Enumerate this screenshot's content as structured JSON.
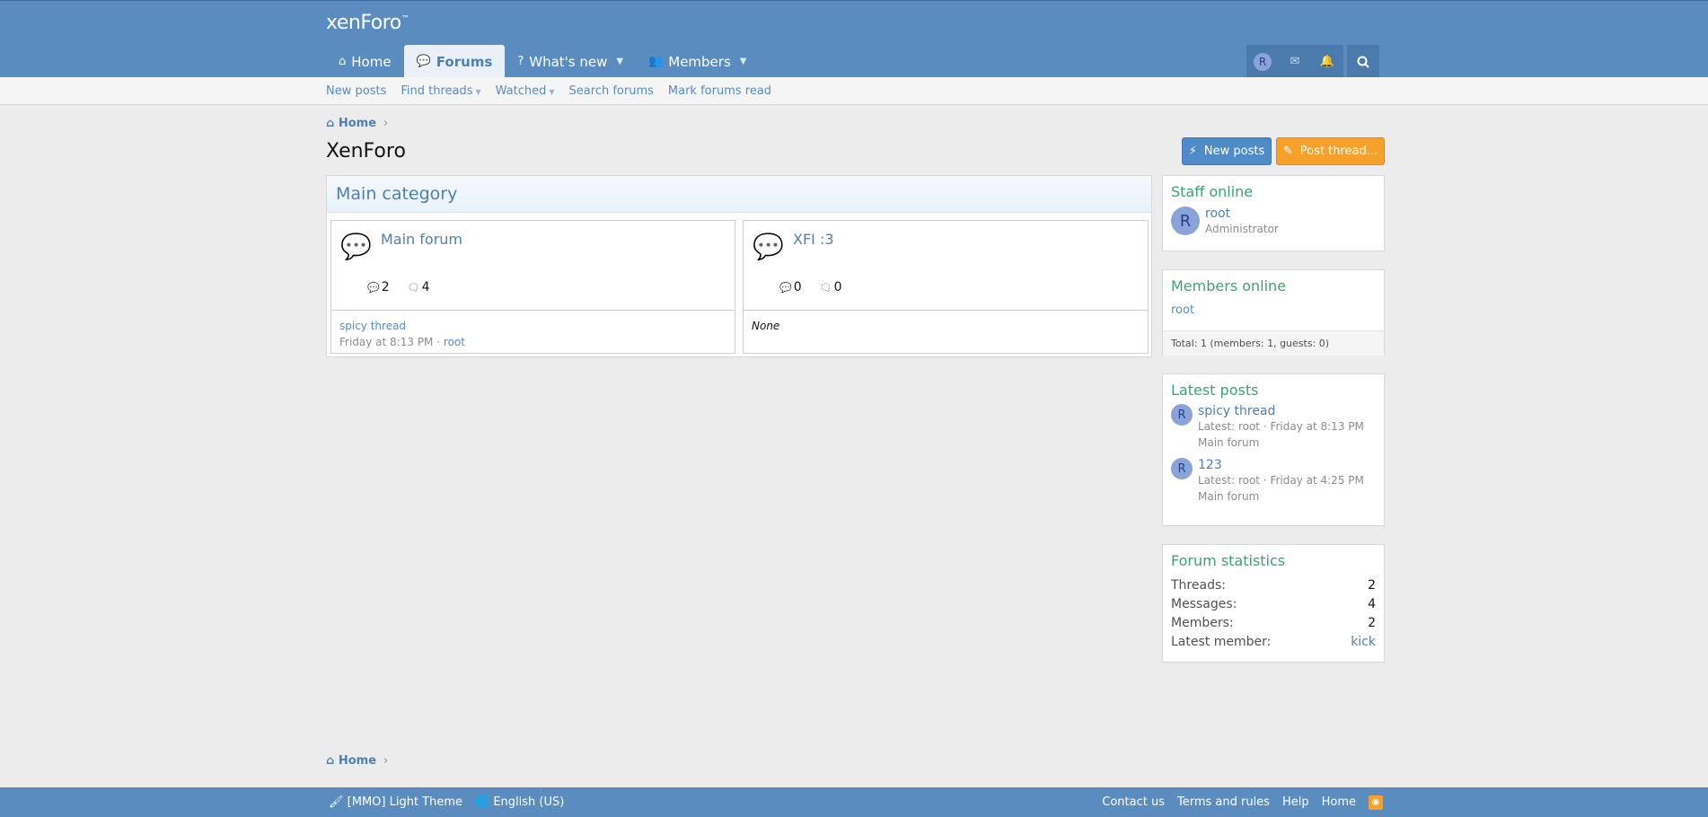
{
  "header": {
    "logo": "xenForo",
    "logo_mark": "™",
    "tabs": [
      {
        "label": "Home",
        "icon": "home-icon"
      },
      {
        "label": "Forums",
        "icon": "comment-icon"
      },
      {
        "label": "What's new",
        "icon": "question-icon"
      },
      {
        "label": "Members",
        "icon": "users-icon"
      }
    ],
    "user_tools": {
      "avatar_letter": "R"
    }
  },
  "subnav": {
    "items": [
      "New posts",
      "Find threads",
      "Watched",
      "Search forums",
      "Mark forums read"
    ]
  },
  "breadcrumb": {
    "home": "Home",
    "sep": "›"
  },
  "page": {
    "title": "XenForo",
    "new_posts_button": "New posts",
    "post_thread_button": "Post thread..."
  },
  "category": {
    "title": "Main category",
    "forums": [
      {
        "title": "Main forum",
        "threads": "2",
        "messages": "4",
        "last_thread": "spicy thread",
        "last_date": "Friday at 8:13 PM",
        "last_sep": "·",
        "last_user": "root"
      },
      {
        "title": "XFI :3",
        "threads": "0",
        "messages": "0",
        "last_none": "None"
      }
    ]
  },
  "sidebar": {
    "staff": {
      "title": "Staff online",
      "name": "root",
      "role": "Administrator",
      "avatar_letter": "R"
    },
    "members": {
      "title": "Members online",
      "list": "root",
      "total": "Total: 1 (members: 1, guests: 0)"
    },
    "latest": {
      "title": "Latest posts",
      "items": [
        {
          "title": "spicy thread",
          "meta": "Latest: root · Friday at 8:13 PM",
          "forum": "Main forum",
          "avatar_letter": "R"
        },
        {
          "title": "123",
          "meta": "Latest: root · Friday at 4:25 PM",
          "forum": "Main forum",
          "avatar_letter": "R"
        }
      ]
    },
    "stats": {
      "title": "Forum statistics",
      "rows": [
        {
          "label": "Threads:",
          "value": "2"
        },
        {
          "label": "Messages:",
          "value": "4"
        },
        {
          "label": "Members:",
          "value": "2"
        },
        {
          "label": "Latest member:",
          "value": "kick"
        }
      ]
    }
  },
  "footer": {
    "style": "[MMO] Light Theme",
    "language": "English (US)",
    "links": [
      "Contact us",
      "Terms and rules",
      "Help",
      "Home"
    ]
  },
  "colors": {
    "header": "#5a8cc0",
    "accent_green": "#3ca372",
    "link": "#4f7fb3",
    "post_thread": "#f7a12a"
  }
}
